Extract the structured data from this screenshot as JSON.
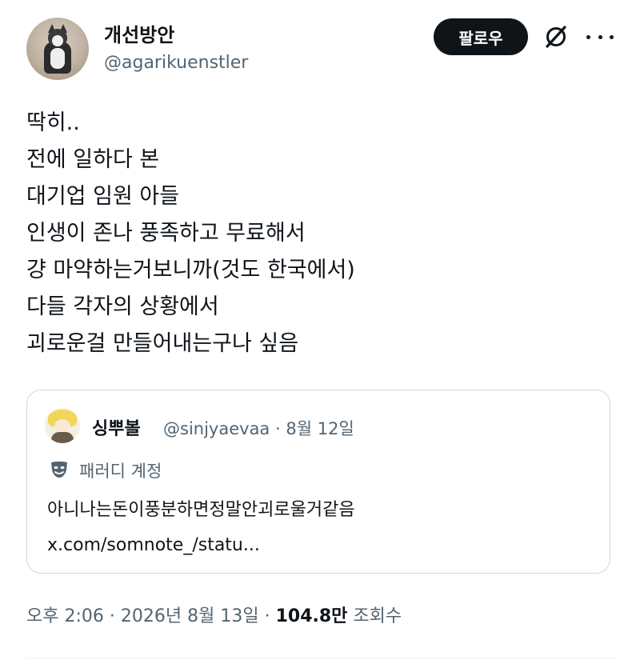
{
  "author": {
    "display_name": "개선방안",
    "handle": "@agarikuenstler"
  },
  "actions": {
    "follow_label": "팔로우",
    "grok_icon": "grok-icon",
    "more_icon": "more-icon"
  },
  "tweet": {
    "lines": [
      "딱히..",
      "전에 일하다 본",
      "대기업 임원 아들",
      "인생이 존나 풍족하고 무료해서",
      "걍 마약하는거보니까(것도 한국에서)",
      "다들 각자의 상황에서",
      "괴로운걸 만들어내는구나 싶음"
    ]
  },
  "quote": {
    "display_name": "싱뿌볼",
    "handle": "@sinjyaevaa",
    "separator": "·",
    "date": "8월 12일",
    "badge_label": "패러디 계정",
    "badge_icon": "theater-mask-icon",
    "text": "아니나는돈이풍분하면정말안괴로울거같음",
    "link": "x.com/somnote_/statu..."
  },
  "meta": {
    "time": "오후 2:06",
    "separator": "·",
    "date": "2026년 8월 13일",
    "views_count": "104.8만",
    "views_label": "조회수"
  },
  "colors": {
    "text_primary": "#0f1419",
    "text_secondary": "#536471",
    "border": "#cfd9de",
    "button_bg": "#0f1419",
    "button_text": "#ffffff"
  }
}
